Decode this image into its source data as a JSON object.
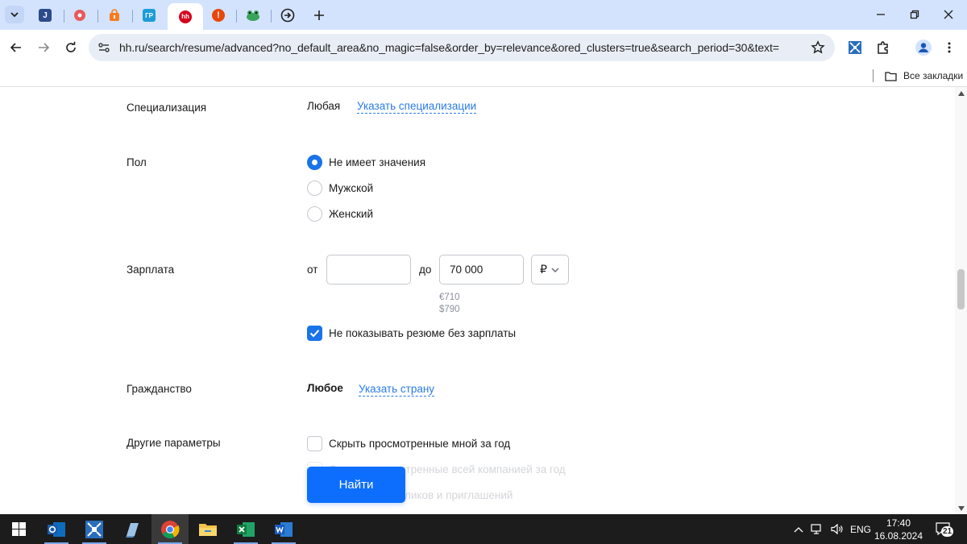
{
  "browser": {
    "tabs": [
      {
        "icon": "j-icon",
        "letter": "J",
        "color": "#2d4a8a"
      },
      {
        "icon": "record-icon",
        "letter": "",
        "color": "#e85a5a"
      },
      {
        "icon": "shopping-bag-icon",
        "letter": "",
        "color": "#f47c20"
      },
      {
        "icon": "gr-icon",
        "letter": "ГР",
        "color": "#1f9bd7"
      },
      {
        "icon": "hh-icon",
        "letter": "hh",
        "color": "#d6001c"
      },
      {
        "icon": "alert-icon",
        "letter": "!",
        "color": "#e8470a"
      },
      {
        "icon": "frog-icon",
        "letter": "",
        "color": "#3aa35a"
      },
      {
        "icon": "arrow-circle-icon",
        "letter": "",
        "color": "#1f1f1f"
      }
    ],
    "url": "hh.ru/search/resume/advanced?no_default_area&no_magic=false&order_by=relevance&ored_clusters=true&search_period=30&text=",
    "bookmarks_all_label": "Все закладки"
  },
  "form": {
    "specialization": {
      "label": "Специализация",
      "value": "Любая",
      "link": "Указать специализации"
    },
    "gender": {
      "label": "Пол",
      "options": [
        {
          "label": "Не имеет значения",
          "checked": true
        },
        {
          "label": "Мужской",
          "checked": false
        },
        {
          "label": "Женский",
          "checked": false
        }
      ]
    },
    "salary": {
      "label": "Зарплата",
      "from_label": "от",
      "from_value": "",
      "to_label": "до",
      "to_value": "70 000",
      "currency": "₽",
      "conv_eur": "€710",
      "conv_usd": "$790",
      "hide_no_salary_label": "Не показывать резюме без зарплаты",
      "hide_no_salary_checked": true
    },
    "citizenship": {
      "label": "Гражданство",
      "value": "Любое",
      "link": "Указать страну"
    },
    "other": {
      "label": "Другие параметры",
      "options": [
        {
          "label": "Скрыть просмотренные мной за год"
        },
        {
          "label": "Скрыть просмотренные всей компанией за год"
        },
        {
          "label": "Скрыть без откликов и приглашений"
        }
      ]
    },
    "search_button": "Найти"
  },
  "taskbar": {
    "apps": [
      {
        "name": "outlook",
        "icon": "outlook-icon"
      },
      {
        "name": "network-tool",
        "icon": "network-icon"
      },
      {
        "name": "notepad",
        "icon": "notepad-icon"
      },
      {
        "name": "chrome",
        "icon": "chrome-icon"
      },
      {
        "name": "explorer",
        "icon": "folder-icon"
      },
      {
        "name": "excel",
        "icon": "excel-icon"
      },
      {
        "name": "word",
        "icon": "word-icon"
      }
    ],
    "lang": "ENG",
    "time": "17:40",
    "date": "16.08.2024",
    "notifications": "21"
  }
}
